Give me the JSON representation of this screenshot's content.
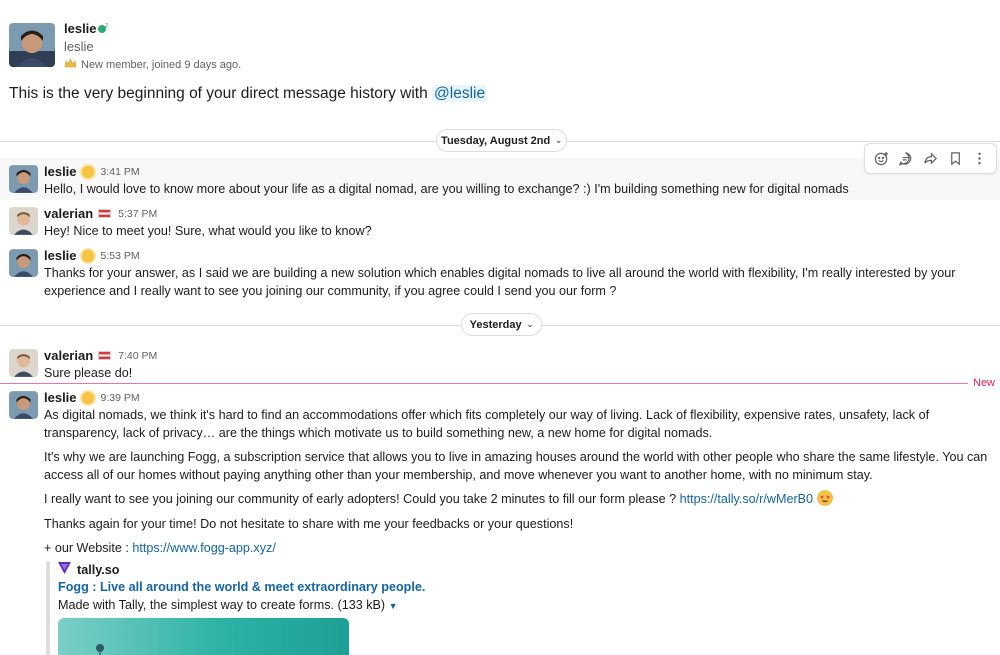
{
  "intro": {
    "name": "leslie",
    "handle": "leslie",
    "new_member": "New member, joined 9 days ago.",
    "beginning_text": "This is the very beginning of your direct message history with",
    "mention": "@leslie"
  },
  "dividers": {
    "first": "Tuesday, August 2nd",
    "second": "Yesterday"
  },
  "messages": [
    {
      "author": "leslie",
      "time": "3:41 PM",
      "text": "Hello, I would love to know more about your life as a digital nomad, are you willing to exchange? :) I'm building something new for digital nomads"
    },
    {
      "author": "valerian",
      "time": "5:37 PM",
      "text": "Hey! Nice to meet you! Sure, what would you like to know?"
    },
    {
      "author": "leslie",
      "time": "5:53 PM",
      "text": "Thanks for your answer, as I said we are building a new solution which enables digital nomads to live all around the world with flexibility, I'm really interested by your experience and I really want to see you joining our community, if you agree could I send you our form ?"
    },
    {
      "author": "valerian",
      "time": "7:40 PM",
      "text": "Sure please do!"
    },
    {
      "author": "leslie",
      "time": "9:39 PM",
      "p1": "As digital nomads, we think it's hard to find an accommodations offer which fits completely our way of living. Lack of flexibility, expensive rates, unsafety, lack of transparency, lack of privacy… are the things which motivate us to build something new, a new home for digital nomads.",
      "p2": "It's why we are launching Fogg, a subscription service that allows you to live in amazing houses around the world with other people who share the same lifestyle. You can access all of our homes without paying anything other than your membership, and move whenever you want to another home, with no minimum stay.",
      "p3": "I really want to see you joining our community of early adopters! Could you take 2 minutes to fill our form please ?",
      "p3_link": "https://tally.so/r/wMerB0",
      "p4": "Thanks again for your time! Do not hesitate to share with me your feedbacks or your questions!",
      "p5": "+ our Website :",
      "p5_link": "https://www.fogg-app.xyz/"
    }
  ],
  "new_marker": "New",
  "unfurl": {
    "site": "tally.so",
    "title": "Fogg : Live all around the world & meet extraordinary people.",
    "description": "Made with Tally, the simplest way to create forms. (133 kB)"
  },
  "toolbar": {
    "icons": [
      "add-reaction-icon",
      "reply-in-thread-icon",
      "forward-icon",
      "bookmark-icon",
      "more-actions-icon"
    ]
  },
  "colors": {
    "link": "#1264a3",
    "new_marker": "#e01e5a",
    "mention_bg": "#e8f5fa"
  }
}
